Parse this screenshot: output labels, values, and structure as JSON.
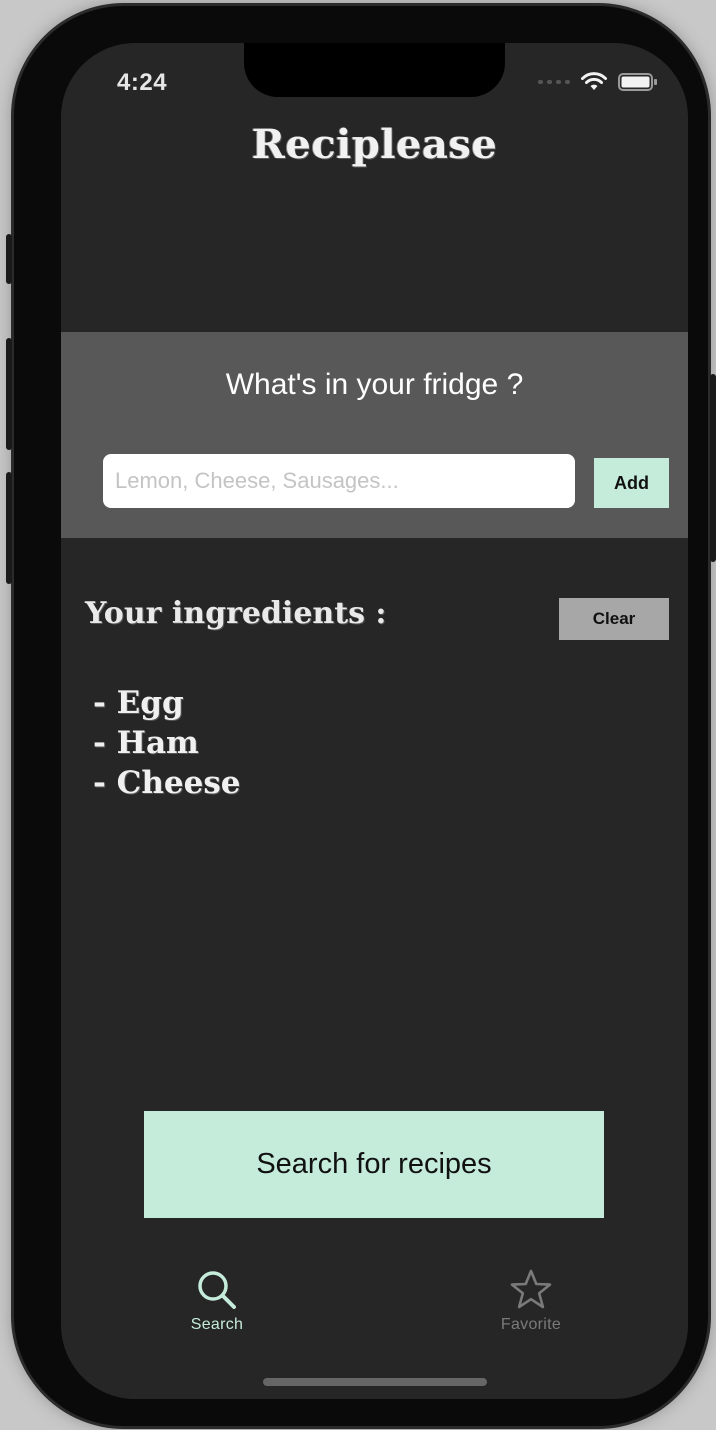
{
  "status_bar": {
    "time": "4:24"
  },
  "app": {
    "title": "Reciplease"
  },
  "fridge": {
    "question": "What's in your fridge ?",
    "input_placeholder": "Lemon, Cheese, Sausages...",
    "input_value": "",
    "add_label": "Add"
  },
  "ingredients": {
    "heading": "Your ingredients :",
    "clear_label": "Clear",
    "items": [
      "- Egg",
      "- Ham",
      "- Cheese"
    ]
  },
  "search_button_label": "Search for recipes",
  "tab_bar": {
    "tabs": [
      {
        "label": "Search",
        "icon": "search-icon",
        "selected": true
      },
      {
        "label": "Favorite",
        "icon": "star-icon",
        "selected": false
      }
    ]
  },
  "colors": {
    "accent": "#c5ebdb",
    "background": "#262626",
    "panel": "#585858",
    "clear_button": "#a7a7a7",
    "tab_selected": "#c5ebdb",
    "tab_unselected": "#7a7a7a"
  }
}
